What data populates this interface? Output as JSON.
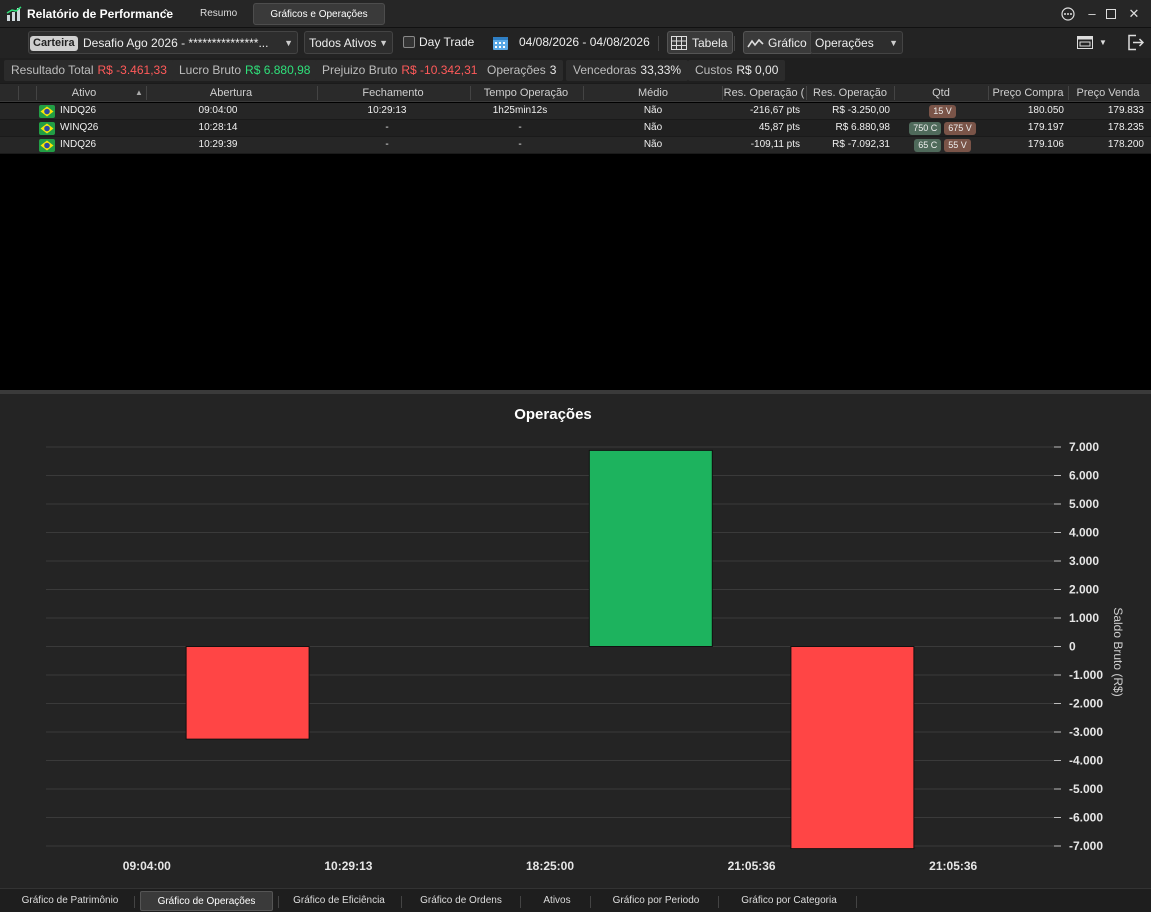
{
  "window": {
    "title": "Relatório de Performance",
    "tabs": [
      {
        "label": "Resumo",
        "active": false
      },
      {
        "label": "Gráficos e Operações",
        "active": true
      }
    ]
  },
  "toolbar": {
    "carteira_tag": "Carteira",
    "carteira_value": "Desafio Ago 2026 - ***************...",
    "ativos_value": "Todos Ativos",
    "day_trade_label": "Day Trade",
    "day_trade_checked": false,
    "date_range": "04/08/2026 - 04/08/2026",
    "tabela_label": "Tabela",
    "grafico_label": "Gráfico",
    "chart_select_value": "Operações"
  },
  "summary": [
    {
      "label": "Resultado Total",
      "value": "R$ -3.461,33",
      "tone": "neg"
    },
    {
      "label": "Lucro Bruto",
      "value": "R$ 6.880,98",
      "tone": "pos"
    },
    {
      "label": "Prejuizo Bruto",
      "value": "R$ -10.342,31",
      "tone": "neg"
    },
    {
      "label": "Operações",
      "value": "3",
      "tone": "neu"
    },
    {
      "label": "Vencedoras",
      "value": "33,33%",
      "tone": "neu"
    },
    {
      "label": "Custos",
      "value": "R$ 0,00",
      "tone": "neu"
    }
  ],
  "table": {
    "columns": [
      "Ativo",
      "Abertura",
      "Fechamento",
      "Tempo Operação",
      "Médio",
      "Res. Operação (",
      "Res. Operação",
      "Qtd",
      "Preço Compra",
      "Preço Venda"
    ],
    "rows": [
      {
        "ativo": "INDQ26",
        "abertura": "09:04:00",
        "fechamento": "10:29:13",
        "tempo": "1h25min12s",
        "medio": "Não",
        "res_pts": "-216,67 pts",
        "res_brl": "R$ -3.250,00",
        "tone": "neg",
        "qtd_c": "",
        "qtd_v": "15 V",
        "preco_compra": "180.050",
        "preco_venda": "179.833"
      },
      {
        "ativo": "WINQ26",
        "abertura": "10:28:14",
        "fechamento": "-",
        "tempo": "-",
        "medio": "Não",
        "res_pts": "45,87 pts",
        "res_brl": "R$ 6.880,98",
        "tone": "pos",
        "qtd_c": "750 C",
        "qtd_v": "675 V",
        "preco_compra": "179.197",
        "preco_venda": "178.235"
      },
      {
        "ativo": "INDQ26",
        "abertura": "10:29:39",
        "fechamento": "-",
        "tempo": "-",
        "medio": "Não",
        "res_pts": "-109,11 pts",
        "res_brl": "R$ -7.092,31",
        "tone": "neg",
        "qtd_c": "65 C",
        "qtd_v": "55 V",
        "preco_compra": "179.106",
        "preco_venda": "178.200"
      }
    ]
  },
  "chart_data": {
    "type": "bar",
    "title": "Operações",
    "ylabel": "Saldo Bruto (R$)",
    "xlabel": "",
    "ylim": [
      -7000,
      7000
    ],
    "yticks": [
      7000,
      6000,
      5000,
      4000,
      3000,
      2000,
      1000,
      0,
      -1000,
      -2000,
      -3000,
      -4000,
      -5000,
      -6000,
      -7000
    ],
    "ytick_labels": [
      "7.000",
      "6.000",
      "5.000",
      "4.000",
      "3.000",
      "2.000",
      "1.000",
      "0",
      "-1.000",
      "-2.000",
      "-3.000",
      "-4.000",
      "-5.000",
      "-6.000",
      "-7.000"
    ],
    "categories": [
      "09:04:00",
      "10:29:13",
      "18:25:00",
      "21:05:36",
      "21:05:36"
    ],
    "bars": [
      {
        "between": [
          0,
          1
        ],
        "value": -3250.0
      },
      {
        "between": [
          2,
          3
        ],
        "value": 6880.98
      },
      {
        "between": [
          3,
          4
        ],
        "value": -7092.31
      }
    ],
    "colors": {
      "positive": "#1db35e",
      "negative": "#ff4545",
      "grid": "#3a3a3a",
      "background": "#242424"
    },
    "grid": true,
    "legend": "none"
  },
  "bottom_tabs": [
    {
      "label": "Gráfico de Patrimônio",
      "active": false
    },
    {
      "label": "Gráfico de Operações",
      "active": true
    },
    {
      "label": "Gráfico de Eficiência",
      "active": false
    },
    {
      "label": "Gráfico de Ordens",
      "active": false
    },
    {
      "label": "Ativos",
      "active": false
    },
    {
      "label": "Gráfico por Periodo",
      "active": false
    },
    {
      "label": "Gráfico por Categoria",
      "active": false
    }
  ]
}
